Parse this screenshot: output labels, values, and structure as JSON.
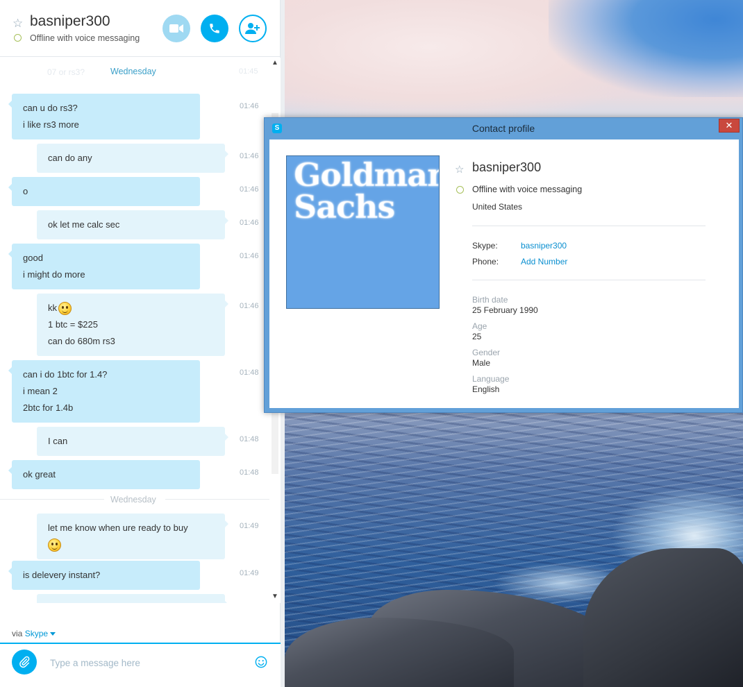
{
  "chat": {
    "contact_name": "basniper300",
    "contact_status": "Offline with voice messaging",
    "ghost_text": "07 or rs3?",
    "ghost_time": "01:45",
    "day_label_1": "Wednesday",
    "day_label_2": "Wednesday",
    "messages": [
      {
        "side": "them",
        "lines": [
          "can u do rs3?",
          "i like rs3 more"
        ],
        "time": "01:46"
      },
      {
        "side": "me",
        "lines": [
          "can do any"
        ],
        "time": "01:46"
      },
      {
        "side": "them",
        "lines": [
          "o"
        ],
        "time": "01:46"
      },
      {
        "side": "me",
        "lines": [
          "ok let me calc sec"
        ],
        "time": "01:46"
      },
      {
        "side": "them",
        "lines": [
          "good",
          "i might do more"
        ],
        "time": "01:46"
      },
      {
        "side": "me",
        "lines": [
          "kk",
          "1 btc = $225",
          "can do 680m rs3"
        ],
        "time": "01:46"
      },
      {
        "side": "them",
        "lines": [
          "can i do 1btc for 1.4?",
          "i mean 2",
          "2btc for 1.4b"
        ],
        "time": "01:48"
      },
      {
        "side": "me",
        "lines": [
          "I can"
        ],
        "time": "01:48"
      },
      {
        "side": "them",
        "lines": [
          "ok great"
        ],
        "time": "01:48"
      },
      {
        "side": "me",
        "lines": [
          "let me know when ure ready to buy"
        ],
        "time": "01:49"
      },
      {
        "side": "them",
        "lines": [
          "is delevery instant?"
        ],
        "time": "01:49"
      }
    ],
    "via_prefix": "via",
    "via_link": "Skype",
    "compose_placeholder": "Type a message here",
    "icons": {
      "favorite": "star-outline-icon",
      "video": "video-camera-icon",
      "call": "phone-icon",
      "add_contact": "add-person-icon",
      "attach": "paperclip-icon",
      "emoticon": "smiley-icon"
    }
  },
  "profile": {
    "window_title": "Contact profile",
    "close_glyph": "✕",
    "app_icon_letter": "S",
    "avatar_text_line1": "Goldman",
    "avatar_text_line2": "Sachs",
    "name": "basniper300",
    "status": "Offline with voice messaging",
    "location": "United States",
    "skype_label": "Skype:",
    "skype_value": "basniper300",
    "phone_label": "Phone:",
    "phone_value": "Add Number",
    "birth_label": "Birth date",
    "birth_value": "25 February 1990",
    "age_label": "Age",
    "age_value": "25",
    "gender_label": "Gender",
    "gender_value": "Male",
    "language_label": "Language",
    "language_value": "English"
  },
  "colors": {
    "skype_blue": "#00aff0",
    "their_bubble": "#c7ecfb",
    "my_bubble": "#e3f4fb",
    "link": "#0a8fd0",
    "status_offline_ring": "#a7c05a",
    "window_frame": "#62a0d8",
    "close_red": "#c9483d",
    "avatar_bg": "#65a4e6"
  }
}
